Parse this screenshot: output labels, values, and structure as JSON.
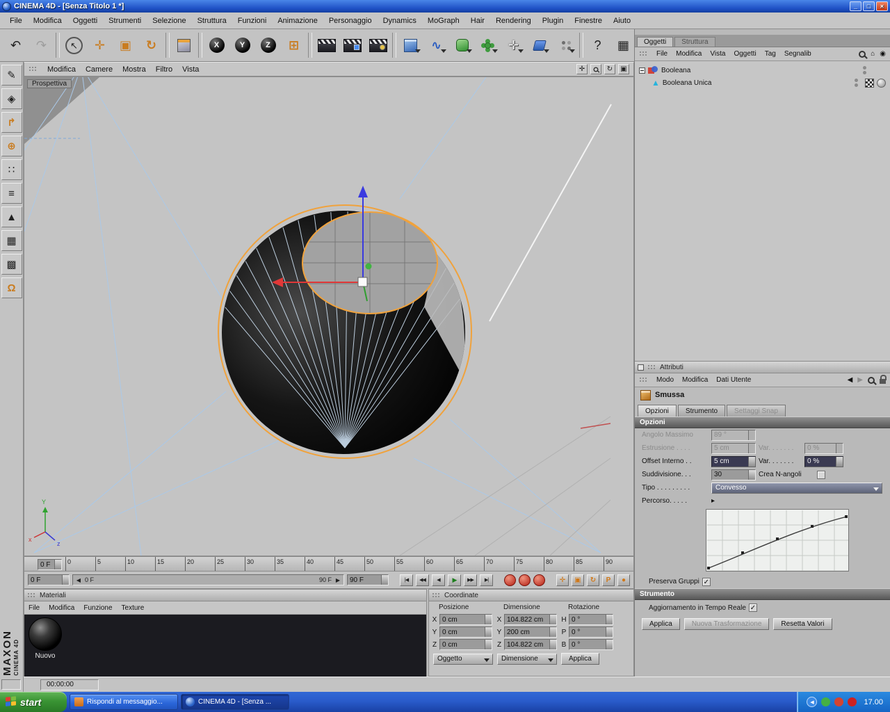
{
  "titlebar": {
    "title": "CINEMA 4D - [Senza Titolo 1 *]",
    "minimize": "_",
    "restore": "□",
    "close": "×"
  },
  "menubar": {
    "items": [
      "File",
      "Modifica",
      "Oggetti",
      "Strumenti",
      "Selezione",
      "Struttura",
      "Funzioni",
      "Animazione",
      "Personaggio",
      "Dynamics",
      "MoGraph",
      "Hair",
      "Rendering",
      "Plugin",
      "Finestre",
      "Aiuto"
    ]
  },
  "toolbar": {
    "undo": "↶",
    "redo": "↷",
    "live_selection": "↖",
    "move": "✛",
    "scale": "▣",
    "rotate": "↻",
    "lock_x": "X",
    "lock_y": "Y",
    "lock_z": "Z",
    "coord_system": "⊞",
    "add_spline": "∿",
    "add_particles": "✛",
    "help": "?",
    "layout": "▦"
  },
  "left_icons": [
    "✎",
    "◈",
    "↱",
    "⊕",
    "∷",
    "≡",
    "▲",
    "▦",
    "▩",
    "Ω"
  ],
  "viewport": {
    "label": "Prospettiva",
    "menu": [
      "Modifica",
      "Camere",
      "Mostra",
      "Filtro",
      "Vista"
    ],
    "icons": {
      "pan": "✛",
      "rotate": "↻",
      "maximize": "▣"
    },
    "axis": {
      "x": "x",
      "y": "Y",
      "z": "z"
    }
  },
  "timeline": {
    "ticks": [
      "0",
      "5",
      "10",
      "15",
      "20",
      "25",
      "30",
      "35",
      "40",
      "45",
      "50",
      "55",
      "60",
      "65",
      "70",
      "75",
      "80",
      "85",
      "90"
    ],
    "frame_field": "0 F",
    "range_start_field": "0 F",
    "scroll_left": "0 F",
    "scroll_right": "90 F",
    "scroll_arrow_left": "◀",
    "scroll_arrow_right": "▶",
    "range_end_field": "90 F",
    "playback": [
      "|◀",
      "◀◀",
      "◀",
      "▶",
      "▶▶",
      "▶|"
    ],
    "toggles": [
      "✛",
      "▣",
      "↻",
      "P",
      "●"
    ]
  },
  "materials": {
    "title": "Materiali",
    "menu": [
      "File",
      "Modifica",
      "Funzione",
      "Texture"
    ],
    "items": [
      {
        "name": "Nuovo"
      }
    ]
  },
  "coordinates": {
    "title": "Coordinate",
    "headers": [
      "Posizione",
      "Dimensione",
      "Rotazione"
    ],
    "pos": {
      "xl": "X",
      "x": "0 cm",
      "yl": "Y",
      "y": "0 cm",
      "zl": "Z",
      "z": "0 cm"
    },
    "dim": {
      "xl": "X",
      "x": "104.822 cm",
      "yl": "Y",
      "y": "200 cm",
      "zl": "Z",
      "z": "104.822 cm"
    },
    "rot": {
      "hl": "H",
      "h": "0 °",
      "pl": "P",
      "p": "0 °",
      "bl": "B",
      "b": "0 °"
    },
    "mode1": "Oggetto",
    "mode2": "Dimensione",
    "apply": "Applica"
  },
  "om": {
    "tabs": [
      "Oggetti",
      "Struttura"
    ],
    "menu": [
      "File",
      "Modifica",
      "Vista",
      "Oggetti",
      "Tag",
      "Segnalib"
    ],
    "home_icon": "⌂",
    "browse_icon": "◉",
    "poly_icon": "▲",
    "objects": [
      {
        "name": "Booleana"
      },
      {
        "name": "Booleana Unica"
      }
    ]
  },
  "attr": {
    "title": "Attributi",
    "menu": [
      "Modo",
      "Modifica",
      "Dati Utente"
    ],
    "nav_back": "◀",
    "nav_fwd": "▶",
    "tool": "Smussa",
    "tabs": [
      "Opzioni",
      "Strumento",
      "Settaggi Snap"
    ],
    "sec_opzioni": "Opzioni",
    "rows": {
      "angolo": {
        "label": "Angolo Massimo",
        "value": "89 °"
      },
      "estrusione": {
        "label": "Estrusione . . . .",
        "value": "5 cm"
      },
      "var1": {
        "label": "Var. . . . . . .",
        "value": "0 %"
      },
      "offset": {
        "label": "Offset Interno . .",
        "value": "5 cm"
      },
      "var2": {
        "label": "Var. . . . . . .",
        "value": "0 %"
      },
      "suddivisione": {
        "label": "Suddivisione. . .",
        "value": "30"
      },
      "crea": {
        "label": "Crea N-angoli"
      },
      "tipo": {
        "label": "Tipo . . . . . . . . .",
        "value": "Convesso"
      },
      "percorso": {
        "label": "Percorso. . . . .",
        "arrow": "▸"
      },
      "preserva": {
        "label": "Preserva Gruppi"
      }
    },
    "sec_strumento": "Strumento",
    "realtime": "Aggiornamento in Tempo Reale",
    "buttons": [
      "Applica",
      "Nuova Trasformazione",
      "Resetta Valori"
    ]
  },
  "status": {
    "time": "00:00:00"
  },
  "taskbar": {
    "start": "start",
    "tasks": [
      "Rispondi al messaggio...",
      "CINEMA 4D - [Senza ..."
    ],
    "collapse": "◀",
    "clock": "17.00"
  },
  "brand": {
    "maxon": "MAXON",
    "c4d": "CINEMA 4D"
  }
}
